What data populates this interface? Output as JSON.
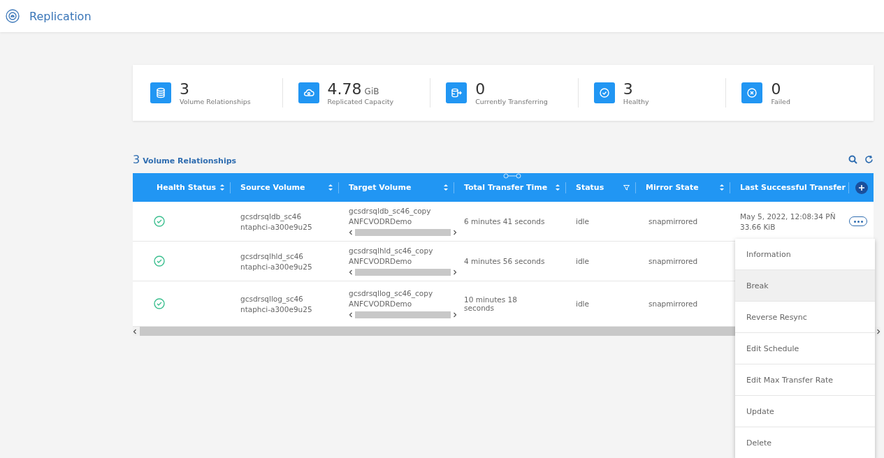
{
  "header": {
    "title": "Replication"
  },
  "stats": [
    {
      "kind": "database",
      "value": "3",
      "label": "Volume Relationships"
    },
    {
      "kind": "cloud",
      "value": "4.78",
      "unit": "GiB",
      "label": "Replicated Capacity"
    },
    {
      "kind": "transfer",
      "value": "0",
      "label": "Currently Transferring"
    },
    {
      "kind": "check",
      "value": "3",
      "label": "Healthy"
    },
    {
      "kind": "failed",
      "value": "0",
      "label": "Failed"
    }
  ],
  "table": {
    "count": "3",
    "title": "Volume Relationships",
    "columns": [
      {
        "label": "Health Status",
        "kind": "sort"
      },
      {
        "label": "Source Volume",
        "kind": "sort"
      },
      {
        "label": "Target Volume",
        "kind": "sort"
      },
      {
        "label": "Total Transfer Time",
        "kind": "sort"
      },
      {
        "label": "Status",
        "kind": "filter"
      },
      {
        "label": "Mirror State",
        "kind": "sort"
      },
      {
        "label": "Last Successful Transfer",
        "kind": "plain"
      }
    ],
    "rows": [
      {
        "source": [
          "gcsdrsqldb_sc46",
          "ntaphci-a300e9u25"
        ],
        "target": [
          "gcsdrsqldb_sc46_copy",
          "ANFCVODRDemo"
        ],
        "time": "6 minutes 41 seconds",
        "status": "idle",
        "mirror": "snapmirrored",
        "last": [
          "May 5, 2022, 12:08:34 PÑ",
          "33.66 KiB"
        ],
        "actions": true
      },
      {
        "source": [
          "gcsdrsqlhld_sc46",
          "ntaphci-a300e9u25"
        ],
        "target": [
          "gcsdrsqlhld_sc46_copy",
          "ANFCVODRDemo"
        ],
        "time": "4 minutes 56 seconds",
        "status": "idle",
        "mirror": "snapmirrored"
      },
      {
        "source": [
          "gcsdrsqllog_sc46",
          "ntaphci-a300e9u25"
        ],
        "target": [
          "gcsdrsqllog_sc46_copy",
          "ANFCVODRDemo"
        ],
        "time": "10 minutes 18 seconds",
        "status": "idle",
        "mirror": "snapmirrored"
      }
    ]
  },
  "menu": [
    {
      "label": "Information",
      "selected": false
    },
    {
      "label": "Break",
      "selected": true
    },
    {
      "label": "Reverse Resync",
      "selected": false
    },
    {
      "label": "Edit Schedule",
      "selected": false
    },
    {
      "label": "Edit Max Transfer Rate",
      "selected": false
    },
    {
      "label": "Update",
      "selected": false
    },
    {
      "label": "Delete",
      "selected": false
    }
  ]
}
